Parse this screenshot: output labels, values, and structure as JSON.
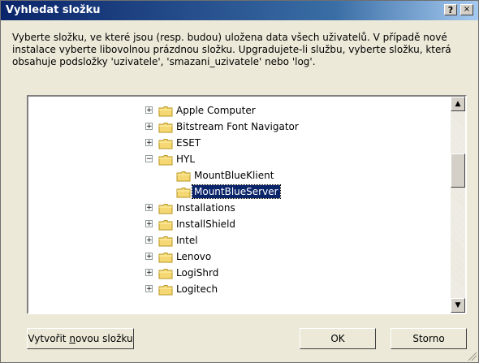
{
  "window": {
    "title": "Vyhledat složku",
    "help_label": "?",
    "close_label": "×"
  },
  "instructions": "Vyberte složku, ve které jsou (resp. budou) uložena data všech uživatelů. V případě nové instalace vyberte libovolnou prázdnou složku. Upgradujete-li službu, vyberte složku, která obsahuje podsložky 'uzivatele', 'smazani_uzivatele' nebo 'log'.",
  "tree": {
    "items": [
      {
        "label": "Apple Computer",
        "expander": "+",
        "selected": false
      },
      {
        "label": "Bitstream Font Navigator",
        "expander": "+",
        "selected": false
      },
      {
        "label": "ESET",
        "expander": "+",
        "selected": false
      },
      {
        "label": "HYL",
        "expander": "−",
        "selected": false
      },
      {
        "label": "MountBlueKlient",
        "expander": "",
        "selected": false
      },
      {
        "label": "MountBlueServer",
        "expander": "",
        "selected": true
      },
      {
        "label": "Installations",
        "expander": "+",
        "selected": false
      },
      {
        "label": "InstallShield",
        "expander": "+",
        "selected": false
      },
      {
        "label": "Intel",
        "expander": "+",
        "selected": false
      },
      {
        "label": "Lenovo",
        "expander": "+",
        "selected": false
      },
      {
        "label": "LogiShrd",
        "expander": "+",
        "selected": false
      },
      {
        "label": "Logitech",
        "expander": "+",
        "selected": false
      }
    ]
  },
  "scrollbar": {
    "up_label": "▲",
    "down_label": "▼"
  },
  "buttons": {
    "new_folder_pre": "Vytvořit ",
    "new_folder_hotkey": "n",
    "new_folder_post": "ovou složku",
    "ok_label": "OK",
    "cancel_label": "Storno"
  },
  "colors": {
    "selection": "#0a246a",
    "folder": "#f5d873"
  }
}
